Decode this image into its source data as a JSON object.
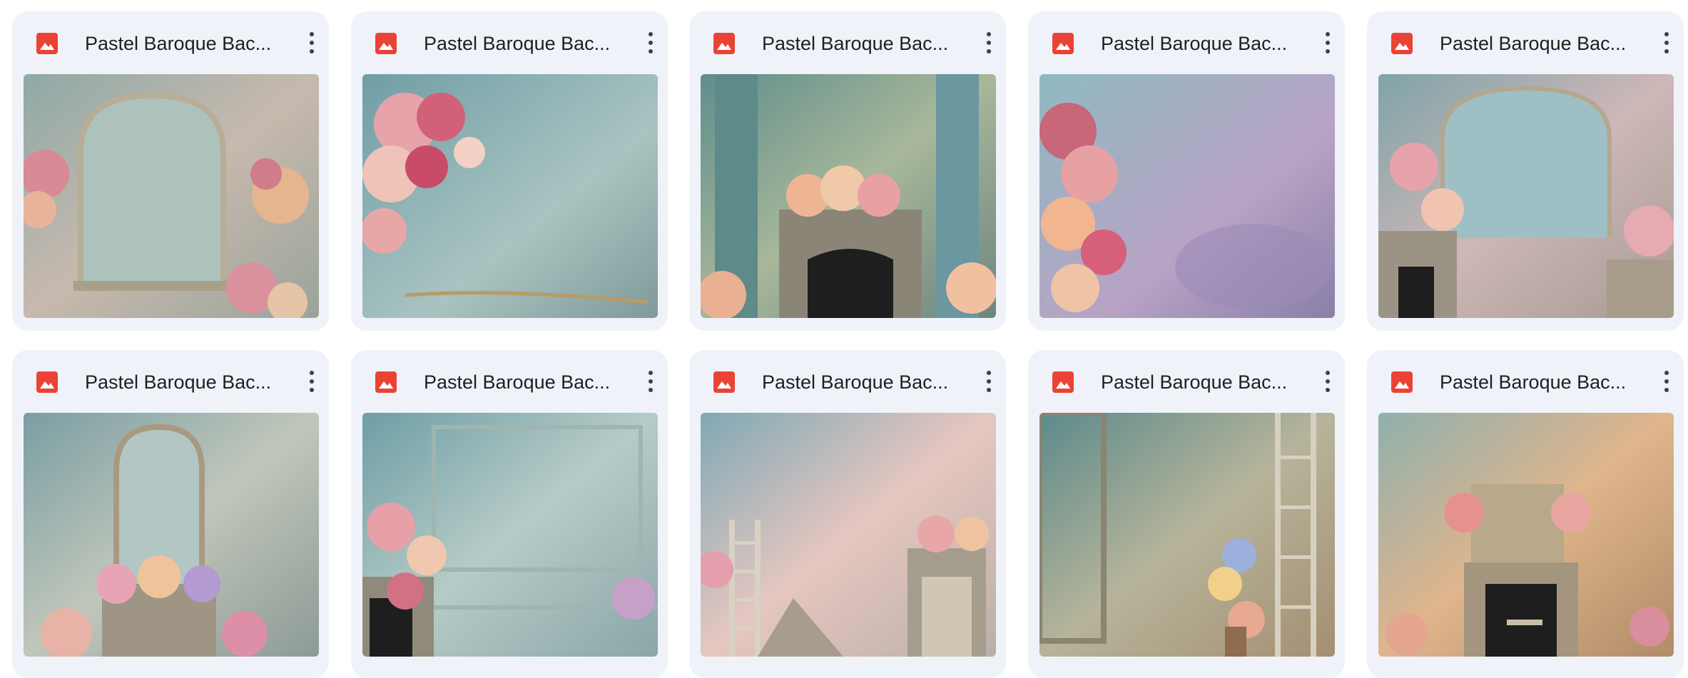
{
  "files": [
    {
      "title": "Pastel Baroque Bac...",
      "icon": "image-file-icon",
      "preview": "arched wall panel with flowers"
    },
    {
      "title": "Pastel Baroque Bac...",
      "icon": "image-file-icon",
      "preview": "blue wall with flower cascade"
    },
    {
      "title": "Pastel Baroque Bac...",
      "icon": "image-file-icon",
      "preview": "fireplace with flowers"
    },
    {
      "title": "Pastel Baroque Bac...",
      "icon": "image-file-icon",
      "preview": "misty wall with roses"
    },
    {
      "title": "Pastel Baroque Bac...",
      "icon": "image-file-icon",
      "preview": "arch with fireplace and flowers"
    },
    {
      "title": "Pastel Baroque Bac...",
      "icon": "image-file-icon",
      "preview": "ornate mirror frame over mantel"
    },
    {
      "title": "Pastel Baroque Bac...",
      "icon": "image-file-icon",
      "preview": "panelled wall with flowers"
    },
    {
      "title": "Pastel Baroque Bac...",
      "icon": "image-file-icon",
      "preview": "ladder and staircase with door"
    },
    {
      "title": "Pastel Baroque Bac...",
      "icon": "image-file-icon",
      "preview": "teal wall with ladder and plants"
    },
    {
      "title": "Pastel Baroque Bac...",
      "icon": "image-file-icon",
      "preview": "ochre wall with mantel and candles"
    }
  ],
  "colors": {
    "card_bg": "#eff3f9",
    "icon_red": "#ea4335",
    "text": "#1f1f1f"
  }
}
